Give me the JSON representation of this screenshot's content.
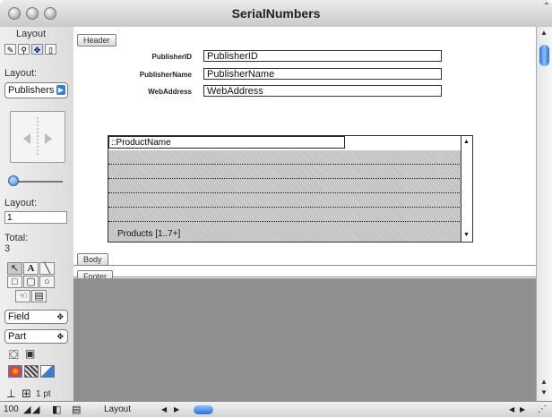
{
  "window": {
    "title": "SerialNumbers"
  },
  "panel": {
    "header_label": "Layout",
    "layout_label": "Layout:",
    "layout_popup": "Publishers",
    "layout_number_label": "Layout:",
    "layout_number": "1",
    "total_label": "Total:",
    "total_value": "3",
    "field_popup": "Field",
    "part_popup": "Part",
    "line_width": "1 pt",
    "zoom": "100"
  },
  "parts": {
    "header": "Header",
    "body": "Body",
    "footer": "Footer"
  },
  "fields": [
    {
      "label": "PublisherID",
      "value": "PublisherID"
    },
    {
      "label": "PublisherName",
      "value": "PublisherName"
    },
    {
      "label": "WebAddress",
      "value": "WebAddress"
    }
  ],
  "portal": {
    "first_field": "::ProductName",
    "footer": "Products [1..7+]"
  },
  "bottombar": {
    "mode": "Layout"
  },
  "colors": {
    "accent": "#3a7bd5",
    "gray_area": "#8f8f8f"
  }
}
